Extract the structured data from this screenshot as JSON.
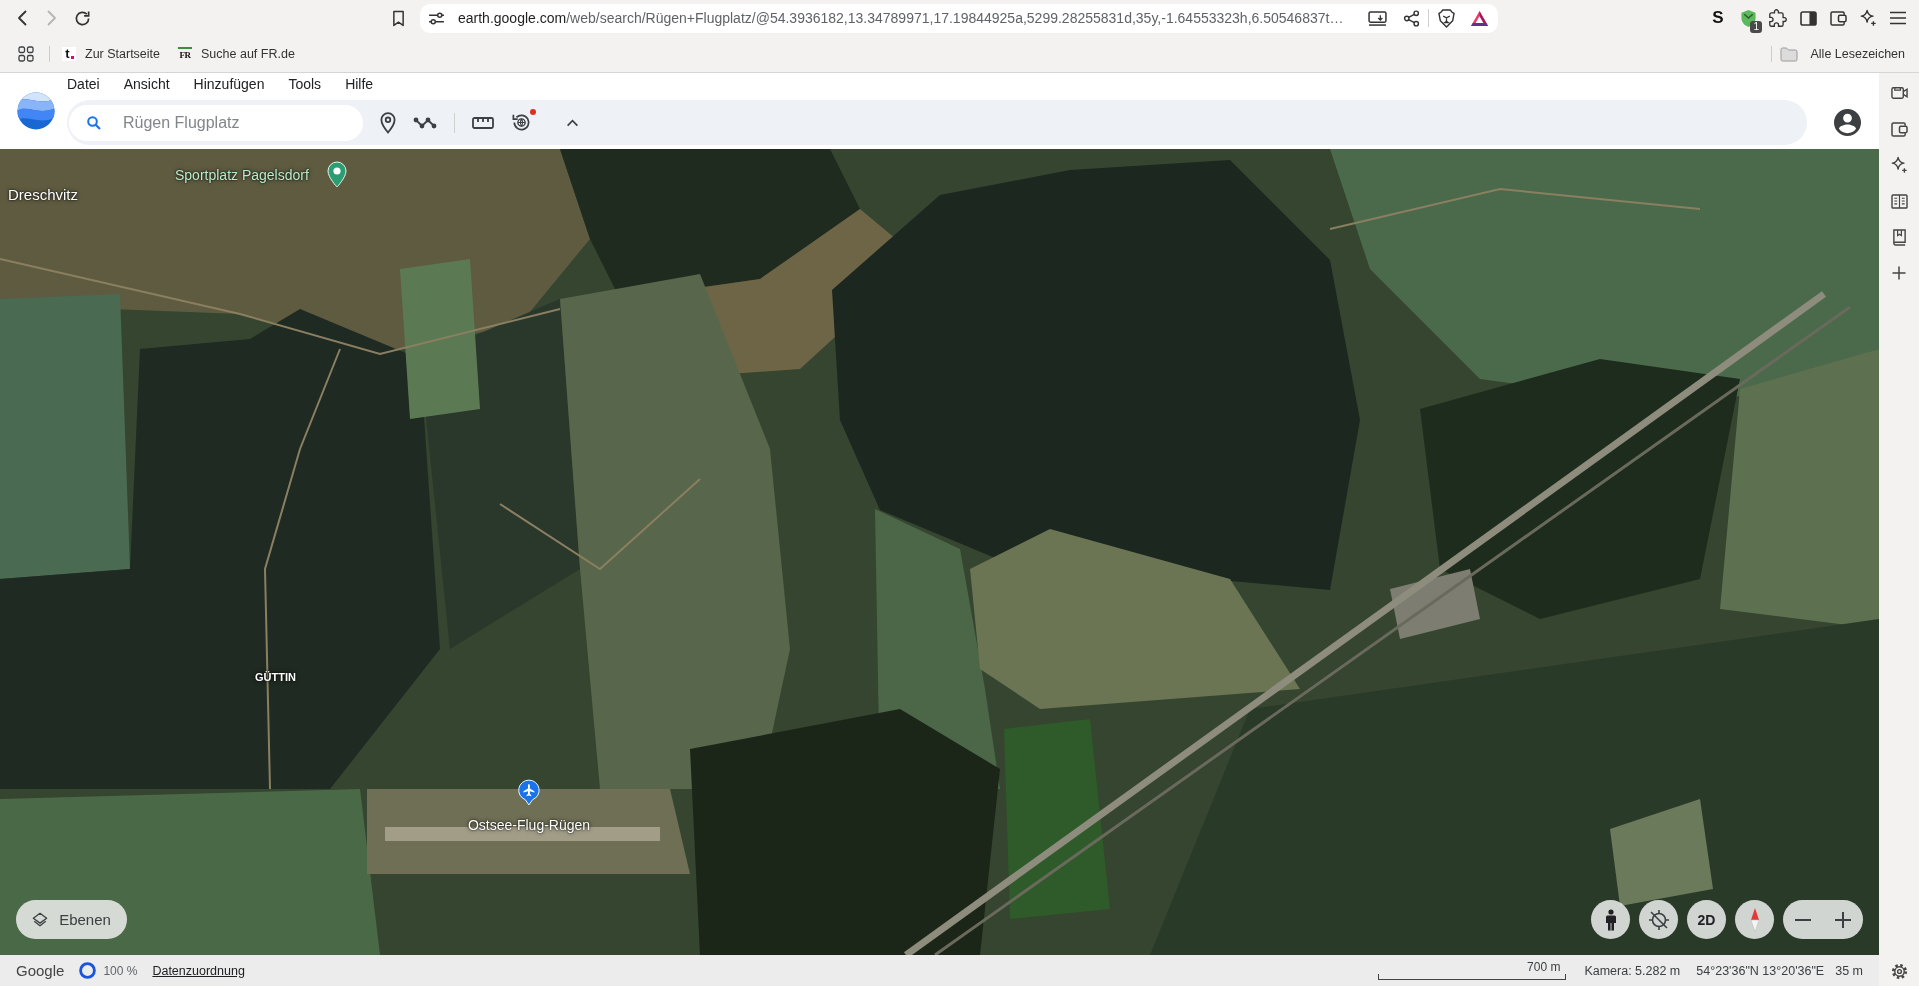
{
  "browser": {
    "nav_buttons": [
      {
        "kind": "back",
        "disabled": false
      },
      {
        "kind": "forward",
        "disabled": true
      },
      {
        "kind": "reload",
        "disabled": false
      }
    ],
    "address": {
      "host": "earth.google.com",
      "path": "/web/search/Rügen+Flugplatz/@54.3936182,13.34789971,17.19844925a,5299.28255831d,35y,-1.64553323h,6.50546837t…"
    },
    "extensions": [
      {
        "kind": "letter",
        "text": "S"
      },
      {
        "kind": "shield",
        "badge": "1"
      }
    ]
  },
  "bookmarks_bar": {
    "items": [
      {
        "favicon": "t",
        "label": "Zur Startseite"
      },
      {
        "favicon": "FR",
        "label": "Suche auf FR.de"
      }
    ],
    "all_bookmarks": "Alle Lesezeichen"
  },
  "app": {
    "menu": [
      "Datei",
      "Ansicht",
      "Hinzufügen",
      "Tools",
      "Hilfe"
    ],
    "search": {
      "placeholder": "Rügen Flugplatz"
    },
    "tools": [
      {
        "kind": "place",
        "notification": false
      },
      {
        "kind": "path",
        "notification": false
      },
      {
        "kind": "ruler",
        "notification": false
      },
      {
        "kind": "history",
        "notification": true
      },
      {
        "kind": "collapse",
        "notification": false
      }
    ]
  },
  "map": {
    "labels": [
      {
        "kind": "poi",
        "text": "Sportplatz Pagelsdorf"
      },
      {
        "kind": "town",
        "text": "Dreschvitz"
      },
      {
        "kind": "village",
        "text": "GÜTTIN"
      },
      {
        "kind": "airport",
        "text": "Ostsee-Flug-Rügen"
      }
    ],
    "layers_button": "Ebenen",
    "view_button": "2D"
  },
  "status_bar": {
    "brand": "Google",
    "loading": "100 %",
    "attribution_link": "Datenzuordnung",
    "scale": "700 m",
    "camera": "Kamera: 5.282 m",
    "coordinates": "54°23'36\"N 13°20'36\"E",
    "elevation": "35 m"
  }
}
